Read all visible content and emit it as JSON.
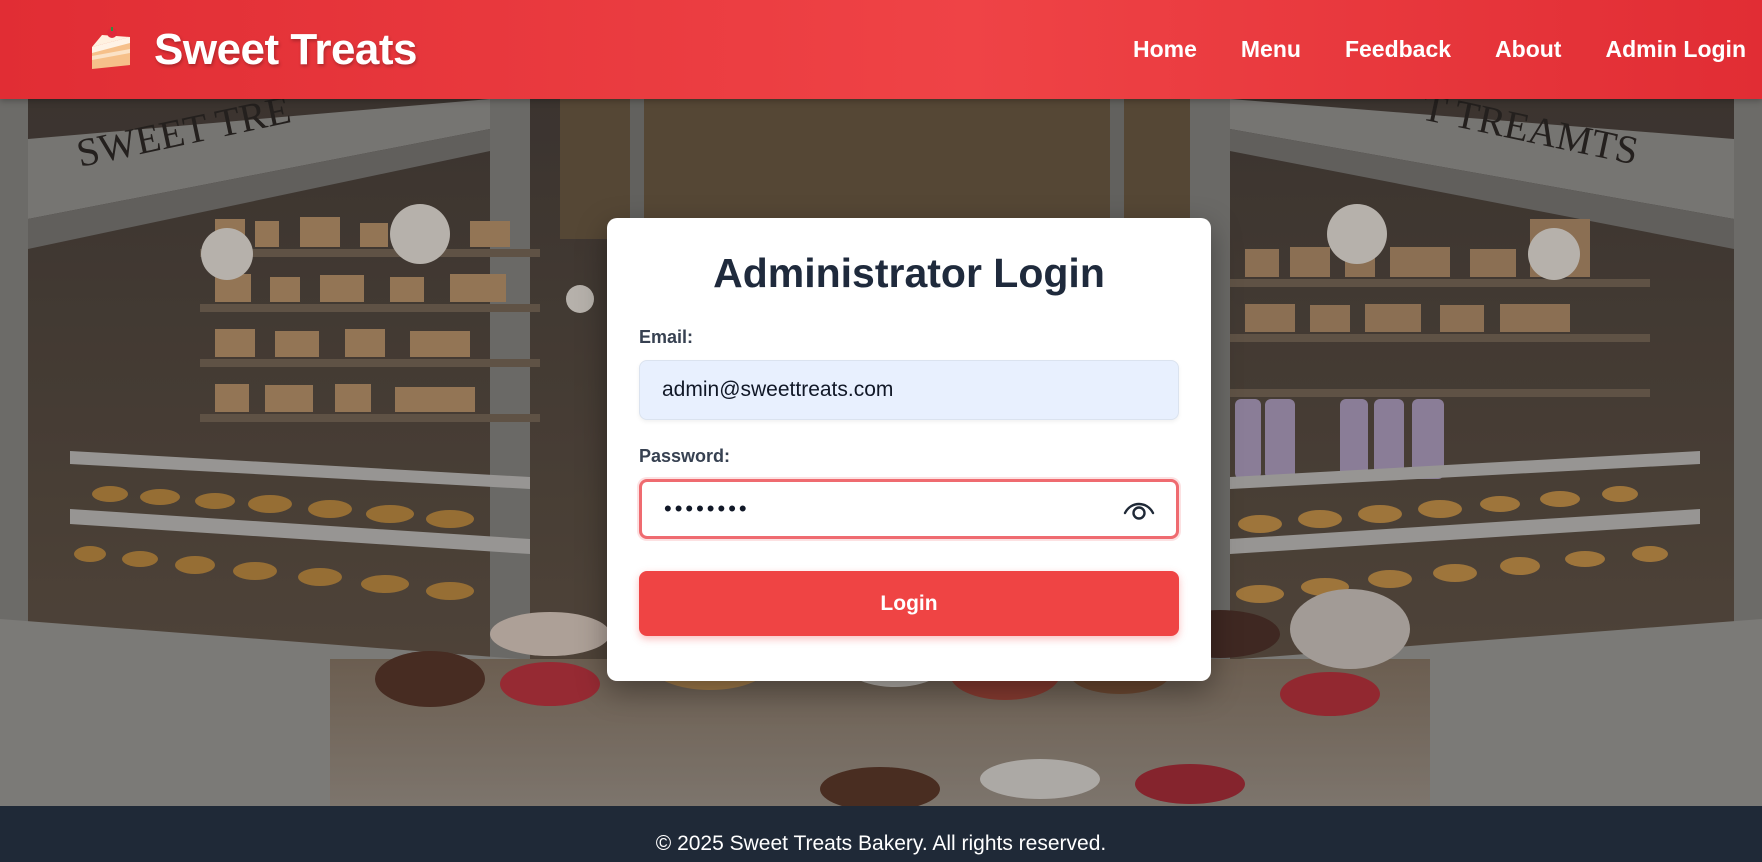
{
  "header": {
    "brand_icon": "cake-slice-icon",
    "brand_name": "Sweet Treats",
    "nav": [
      "Home",
      "Menu",
      "Feedback",
      "About",
      "Admin Login"
    ],
    "accent_color": "#ef4444"
  },
  "hero": {
    "storefront_sign_left": "SWEET TRE",
    "storefront_sign_right": "T TREAMTS"
  },
  "login": {
    "title": "Administrator Login",
    "email_label": "Email:",
    "email_value": "admin@sweettreats.com",
    "password_label": "Password:",
    "password_value": "••••••••",
    "password_toggle_icon": "eye-icon",
    "submit_label": "Login"
  },
  "footer": {
    "text": "© 2025 Sweet Treats Bakery. All rights reserved."
  }
}
